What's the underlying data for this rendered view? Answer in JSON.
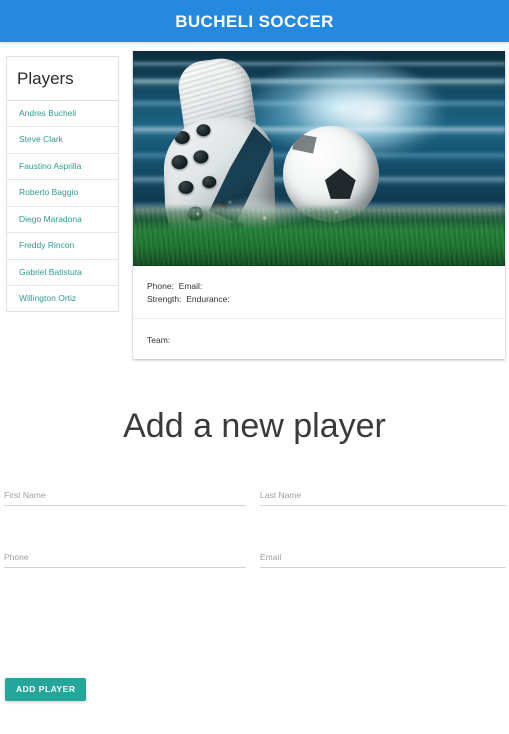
{
  "navbar": {
    "brand": "BUCHELI SOCCER",
    "brand_background": "#2589e0",
    "brand_color": "#ffffff"
  },
  "sidebar": {
    "header": "Players",
    "link_color": "#2e9c92",
    "items": [
      {
        "label": "Andres Bucheli"
      },
      {
        "label": "Steve Clark"
      },
      {
        "label": "Faustino Asprilla"
      },
      {
        "label": "Roberto Baggio"
      },
      {
        "label": "Diego Maradona"
      },
      {
        "label": "Freddy Rincon"
      },
      {
        "label": "Gabriel Batistuta"
      },
      {
        "label": "Willington Ortiz"
      }
    ]
  },
  "player_card": {
    "image_alt": "soccer-cleat-striking-ball",
    "details_line_1": "Phone:  Email:",
    "details_line_2": "Strength:  Endurance:",
    "team_line": "Team:"
  },
  "form": {
    "title": "Add a new player",
    "fields": {
      "first_name": {
        "placeholder": "First Name",
        "value": ""
      },
      "last_name": {
        "placeholder": "Last Name",
        "value": ""
      },
      "phone": {
        "placeholder": "Phone",
        "value": ""
      },
      "email": {
        "placeholder": "Email",
        "value": ""
      }
    },
    "submit_label": "Add Player",
    "submit_color": "#26a69a"
  }
}
